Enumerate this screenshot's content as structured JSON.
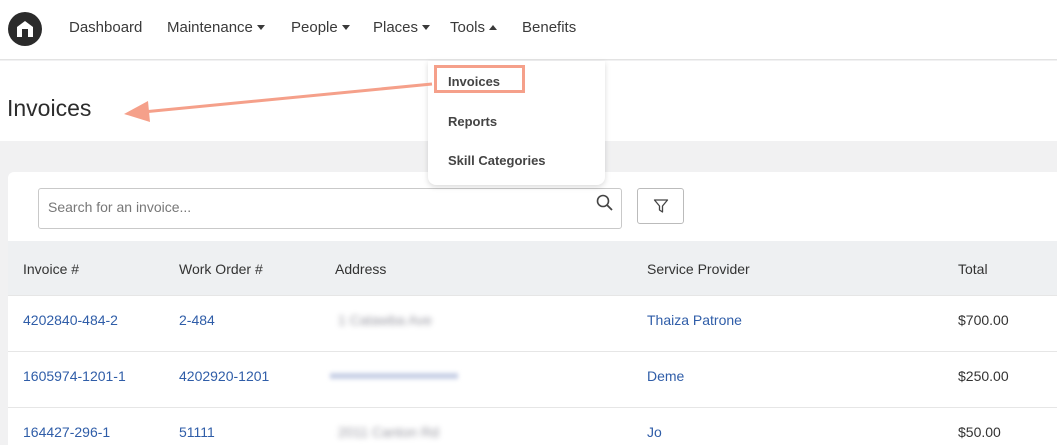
{
  "nav": {
    "items": [
      {
        "label": "Dashboard"
      },
      {
        "label": "Maintenance"
      },
      {
        "label": "People"
      },
      {
        "label": "Places"
      },
      {
        "label": "Tools"
      },
      {
        "label": "Benefits"
      }
    ]
  },
  "dropdown": {
    "items": [
      {
        "label": "Invoices"
      },
      {
        "label": "Reports"
      },
      {
        "label": "Skill Categories"
      }
    ]
  },
  "page": {
    "title": "Invoices"
  },
  "search": {
    "placeholder": "Search for an invoice...",
    "value": ""
  },
  "table": {
    "columns": [
      "Invoice #",
      "Work Order #",
      "Address",
      "Service Provider",
      "Total"
    ],
    "rows": [
      {
        "invoice": "4202840-484-2",
        "work_order": "2-484",
        "address": "1 Catawba Ave",
        "provider": "Thaiza Patrone",
        "total": "$700.00"
      },
      {
        "invoice": "1605974-1201-1",
        "work_order": "4202920-1201",
        "address": "",
        "provider": "Deme",
        "total": "$250.00"
      },
      {
        "invoice": "164427-296-1",
        "work_order": "51111",
        "address": "2011 Canton Rd",
        "provider": "Jo",
        "total": "$50.00"
      }
    ]
  },
  "colors": {
    "accent": "#f5a08a",
    "link": "#2f5da8",
    "header_bg": "#eef0f2"
  }
}
